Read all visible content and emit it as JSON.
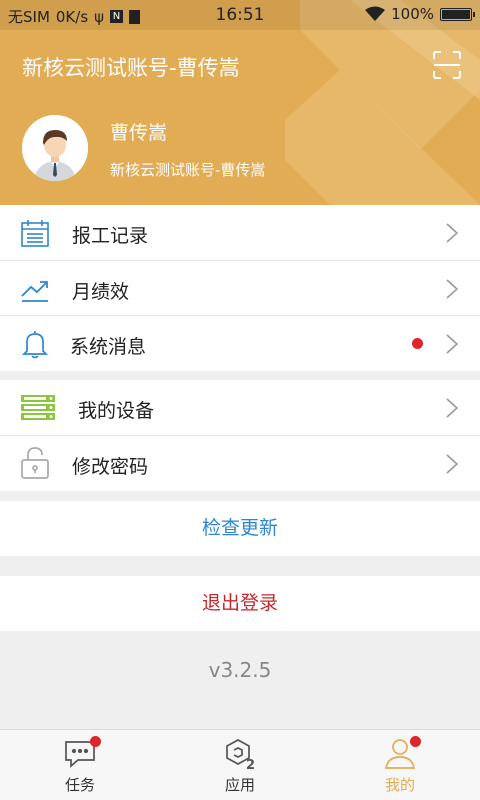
{
  "status_bar": {
    "carrier": "无SIM",
    "speed": "0K/s",
    "time": "16:51",
    "battery": "100%"
  },
  "header": {
    "title": "新核云测试账号-曹传嵩",
    "user_name": "曹传嵩",
    "user_subtitle": "新核云测试账号-曹传嵩",
    "icons": [
      "scan-icon",
      "avatar-icon"
    ]
  },
  "menu": {
    "group1": [
      {
        "label": "报工记录",
        "icon": "calendar-icon"
      },
      {
        "label": "月绩效",
        "icon": "trend-chart-icon"
      },
      {
        "label": "系统消息",
        "icon": "bell-icon",
        "has_badge": true
      }
    ],
    "group2": [
      {
        "label": "我的设备",
        "icon": "server-icon"
      },
      {
        "label": "修改密码",
        "icon": "unlock-icon"
      }
    ]
  },
  "actions": {
    "check_update": "检查更新",
    "logout": "退出登录"
  },
  "version": "v3.2.5",
  "tabbar": {
    "tabs": [
      {
        "label": "任务",
        "icon": "chat-icon",
        "has_badge": true,
        "active": false
      },
      {
        "label": "应用",
        "icon": "apps-icon",
        "has_badge": false,
        "active": false
      },
      {
        "label": "我的",
        "icon": "person-icon",
        "has_badge": true,
        "active": true
      }
    ]
  },
  "colors": {
    "header_bg": "#e2ac54",
    "accent_blue": "#2f86d0",
    "logout_red": "#c8272d",
    "badge_red": "#e0242c",
    "device_green": "#8cc63f",
    "active_tab": "#e2ac54"
  }
}
